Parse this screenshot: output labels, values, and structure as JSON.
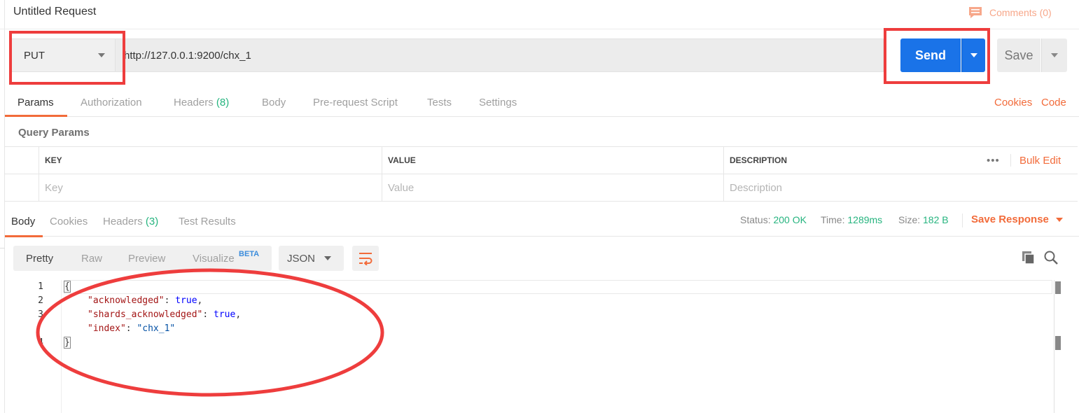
{
  "title_bar": {
    "title": "Untitled Request",
    "comments": "Comments (0)"
  },
  "request": {
    "method": "PUT",
    "url": "http://127.0.0.1:9200/chx_1",
    "send_label": "Send",
    "save_label": "Save"
  },
  "request_tabs": [
    {
      "label": "Params",
      "active": true
    },
    {
      "label": "Authorization"
    },
    {
      "label": "Headers",
      "count": "(8)"
    },
    {
      "label": "Body"
    },
    {
      "label": "Pre-request Script"
    },
    {
      "label": "Tests"
    },
    {
      "label": "Settings"
    }
  ],
  "request_links": {
    "cookies": "Cookies",
    "code": "Code"
  },
  "query_params": {
    "title": "Query Params",
    "headers": [
      "KEY",
      "VALUE",
      "DESCRIPTION"
    ],
    "placeholders": [
      "Key",
      "Value",
      "Description"
    ],
    "more": "•••",
    "bulk_edit": "Bulk Edit"
  },
  "response_tabs": [
    {
      "label": "Body",
      "active": true
    },
    {
      "label": "Cookies"
    },
    {
      "label": "Headers",
      "count": "(3)"
    },
    {
      "label": "Test Results"
    }
  ],
  "response_meta": {
    "status_label": "Status:",
    "status_value": "200 OK",
    "time_label": "Time:",
    "time_value": "1289ms",
    "size_label": "Size:",
    "size_value": "182 B",
    "save_response": "Save Response"
  },
  "format": {
    "options": [
      "Pretty",
      "Raw",
      "Preview",
      "Visualize"
    ],
    "beta": "BETA",
    "language": "JSON"
  },
  "response_body": {
    "line_numbers": [
      "1",
      "2",
      "3",
      "4"
    ],
    "open_brace": "{",
    "close_brace": "}",
    "k1": "\"acknowledged\"",
    "v1": "true",
    "k2": "\"shards_acknowledged\"",
    "v2": "true",
    "k3": "\"index\"",
    "v3": "\"chx_1\""
  },
  "colors": {
    "accent_orange": "#f26b3a",
    "send_blue": "#1a73e8",
    "status_green": "#26b47f",
    "annotation_red": "#ee3d3d"
  },
  "icons": {
    "comments": "comment-icon",
    "wrap": "wrap-lines-icon",
    "copy": "copy-icon",
    "search": "search-icon"
  }
}
